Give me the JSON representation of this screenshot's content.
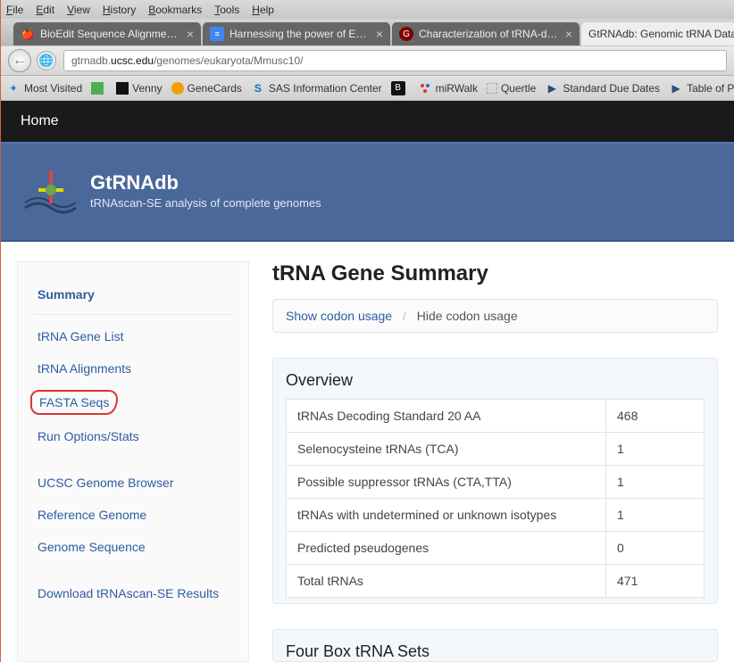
{
  "menu": {
    "items": [
      "File",
      "Edit",
      "View",
      "History",
      "Bookmarks",
      "Tools",
      "Help"
    ]
  },
  "tabs": [
    {
      "label": "BioEdit Sequence Alignment E…",
      "icon": "apple-icon",
      "active": false,
      "close": true
    },
    {
      "label": "Harnessing the power of Exc…",
      "icon": "doc-icon",
      "active": false,
      "close": true
    },
    {
      "label": "Characterization of tRNA-deri…",
      "icon": "g-icon",
      "active": false,
      "close": true
    },
    {
      "label": "GtRNAdb: Genomic tRNA Database",
      "icon": "blank",
      "active": true,
      "close": false
    }
  ],
  "url": {
    "prefix": "gtrnadb.",
    "domain": "ucsc.edu",
    "path": "/genomes/eukaryota/Mmusc10/"
  },
  "bookmarks": [
    {
      "label": "Most Visited",
      "icon": "star-blue"
    },
    {
      "label": "",
      "icon": "green-sq"
    },
    {
      "label": "Venny",
      "icon": "black-sq"
    },
    {
      "label": "GeneCards",
      "icon": "orange-circle"
    },
    {
      "label": "SAS Information Center",
      "icon": "s-blue"
    },
    {
      "label": "",
      "icon": "b-sq"
    },
    {
      "label": "miRWalk",
      "icon": "dots-red"
    },
    {
      "label": "Quertle",
      "icon": "blank"
    },
    {
      "label": "Standard Due Dates",
      "icon": "play-navy"
    },
    {
      "label": "Table of Page Limits",
      "icon": "play-navy"
    }
  ],
  "header": {
    "home": "Home",
    "brand": "GtRNAdb",
    "tagline": "tRNAscan-SE analysis of complete genomes"
  },
  "sidebar": [
    {
      "label": "Summary",
      "current": true
    },
    {
      "label": "tRNA Gene List"
    },
    {
      "label": "tRNA Alignments"
    },
    {
      "label": "FASTA Seqs",
      "highlight": true
    },
    {
      "label": "Run Options/Stats"
    },
    {
      "label": "UCSC Genome Browser",
      "section": true
    },
    {
      "label": "Reference Genome"
    },
    {
      "label": "Genome Sequence"
    },
    {
      "label": "Download tRNAscan-SE Results",
      "section": true
    }
  ],
  "main": {
    "title": "tRNA Gene Summary",
    "codon": {
      "show": "Show codon usage",
      "hide": "Hide codon usage"
    },
    "overview": {
      "title": "Overview",
      "rows": [
        {
          "label": "tRNAs Decoding Standard 20 AA",
          "value": "468"
        },
        {
          "label": "Selenocysteine tRNAs (TCA)",
          "value": "1"
        },
        {
          "label": "Possible suppressor tRNAs (CTA,TTA)",
          "value": "1"
        },
        {
          "label": "tRNAs with undetermined or unknown isotypes",
          "value": "1"
        },
        {
          "label": "Predicted pseudogenes",
          "value": "0"
        },
        {
          "label": "Total tRNAs",
          "value": "471"
        }
      ]
    },
    "fourbox": {
      "title": "Four Box tRNA Sets"
    }
  }
}
